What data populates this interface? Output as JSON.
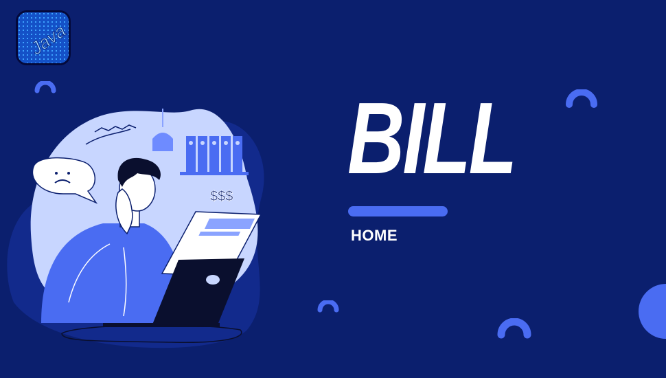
{
  "logo": {
    "text": "Java"
  },
  "hero": {
    "title": "BILL"
  },
  "nav": {
    "home_label": "HOME"
  },
  "illustration": {
    "money_text": "$$$"
  },
  "colors": {
    "background": "#0b1f6e",
    "accent": "#4a6cf2",
    "blob": "#c8d6ff",
    "text": "#ffffff"
  }
}
